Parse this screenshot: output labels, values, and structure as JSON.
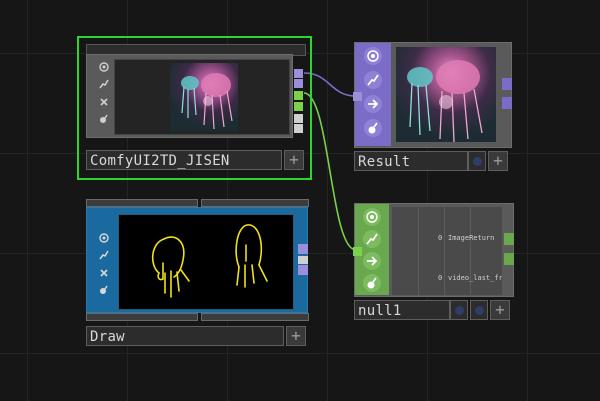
{
  "colors": {
    "background": "#161616",
    "selection": "#2fd52f",
    "comp_strip": "#7a6cc7",
    "dat_strip": "#6aa84f",
    "draw_strip": "#1a6aa0",
    "wire_purple": "#7a6cc7",
    "wire_green": "#7ad14a",
    "stroke_yellow": "#f2e01a"
  },
  "nodes": {
    "comfy": {
      "name": "ComfyUI2TD_JISEN",
      "icons": [
        "viewer-icon",
        "bypass-icon",
        "close-icon",
        "lock-icon"
      ],
      "preview": "jellyfish-image"
    },
    "result": {
      "name": "Result",
      "icons": [
        "viewer-icon",
        "bypass-icon",
        "arrow-right-icon",
        "lock-icon"
      ],
      "preview": "jellyfish-image"
    },
    "draw": {
      "name": "Draw",
      "icons": [
        "viewer-icon",
        "bypass-icon",
        "close-icon",
        "lock-icon"
      ],
      "preview": "yellow-jellyfish-sketch"
    },
    "null1": {
      "name": "null1",
      "icons": [
        "viewer-icon",
        "bypass-icon",
        "arrow-right-icon",
        "lock-icon"
      ],
      "rows": [
        {
          "index": "0",
          "label": "ImageReturn"
        },
        {
          "index": "0",
          "label": "video_last_fr"
        }
      ]
    }
  },
  "add_button": "+"
}
